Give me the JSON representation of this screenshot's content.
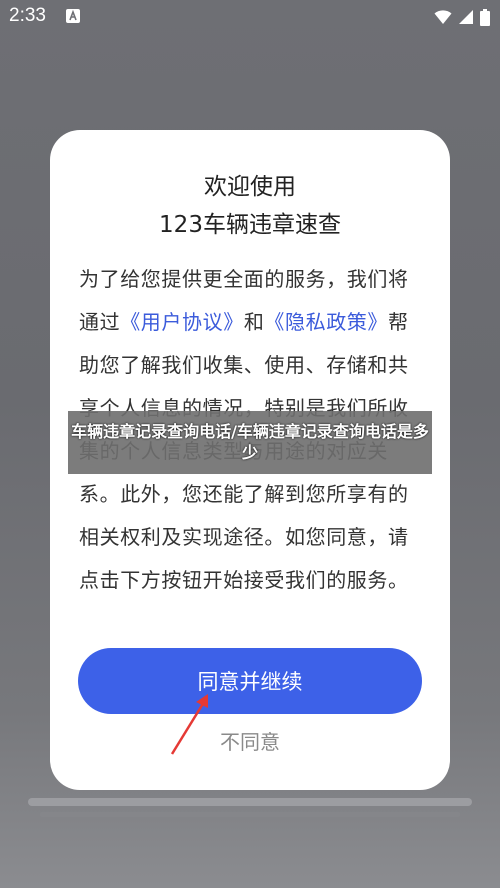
{
  "status_bar": {
    "time": "2:33",
    "notification_icon": "a-icon",
    "wifi_icon": "wifi-icon",
    "signal_icon": "signal-icon",
    "battery_icon": "battery-icon"
  },
  "dialog": {
    "title_line1": "欢迎使用",
    "title_line2": "123车辆违章速查",
    "body_part1": "为了给您提供更全面的服务，我们将通过",
    "link_user_agreement": "《用户协议》",
    "body_part2": "和",
    "link_privacy_policy": "《隐私政策》",
    "body_part3": "帮助您了解我们收集、使用、存储和共享个人信息的情况，特别是我们所收集的个人信息类型与用途的对应关系。此外，您还能了解到您所享有的相关权利及实现途径。如您同意，请点击下方按钮开始接受我们的服务。",
    "agree_button": "同意并继续",
    "disagree_button": "不同意"
  },
  "watermark": {
    "text": "车辆违章记录查询电话/车辆违章记录查询电话是多少"
  },
  "colors": {
    "accent": "#3d61e8",
    "link": "#3b5bdb",
    "arrow": "#e53935"
  }
}
